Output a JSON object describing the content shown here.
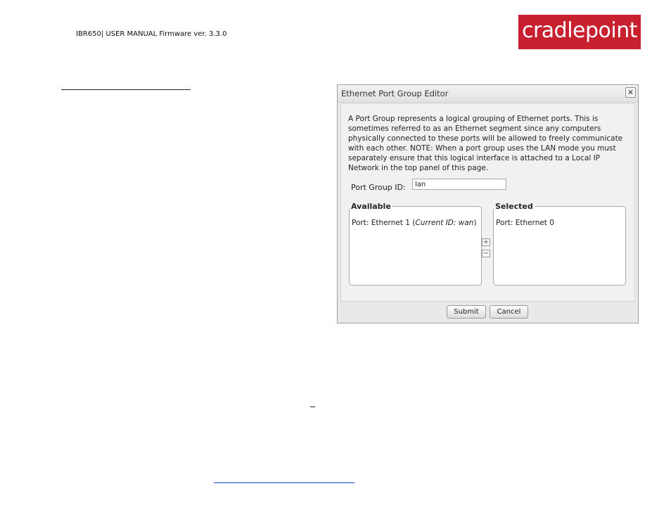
{
  "document": {
    "header": "IBR650| USER MANUAL Firmware ver. 3.3.0",
    "logo_text": "cradlepoint",
    "brand_color": "#c8202f"
  },
  "dialog": {
    "title": "Ethernet Port Group Editor",
    "close_icon": "close-icon",
    "description": "A Port Group represents a logical grouping of Ethernet ports. This is sometimes referred to as an Ethernet segment since any computers physically connected to these ports will be allowed to freely communicate with each other. NOTE: When a port group uses the LAN mode you must separately ensure that this logical interface is attached to a Local IP Network in the top panel of this page.",
    "port_group_id_label": "Port Group ID:",
    "port_group_id_value": "lan",
    "available": {
      "legend": "Available",
      "item_prefix": "Port: Ethernet 1 (",
      "item_italic": "Current ID: wan",
      "item_suffix": ")"
    },
    "selected": {
      "legend": "Selected",
      "item": "Port: Ethernet 0"
    },
    "add_button": "+",
    "remove_button": "−",
    "submit_label": "Submit",
    "cancel_label": "Cancel"
  }
}
